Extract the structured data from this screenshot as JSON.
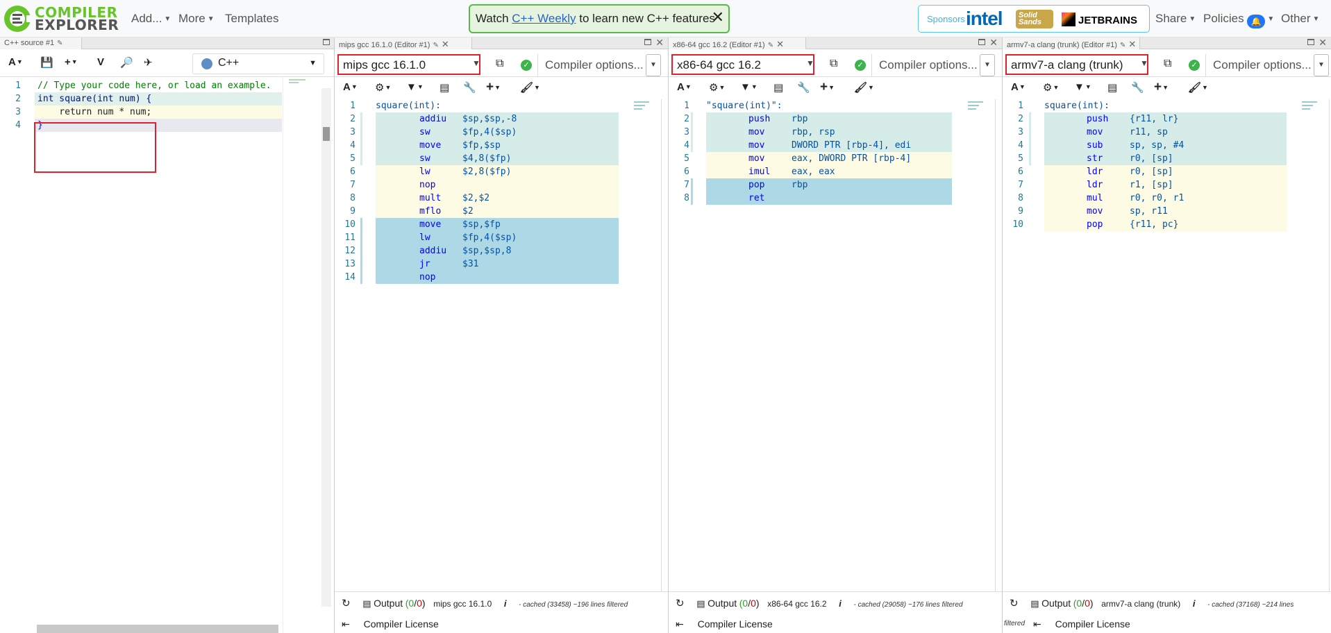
{
  "app": {
    "logo_line1": "COMPILER",
    "logo_line2": "EXPLORER",
    "nav": {
      "add": "Add...",
      "more": "More",
      "templates": "Templates",
      "share": "Share",
      "policies": "Policies",
      "other": "Other"
    },
    "banner": {
      "prefix": "Watch ",
      "link": "C++ Weekly",
      "suffix": " to learn new C++ features"
    },
    "sponsors": {
      "label": "Sponsors",
      "intel": "intel",
      "solid": "Solid Sands",
      "jetbrains": "JETBRAINS"
    }
  },
  "editor": {
    "tab_label": "C++ source #1",
    "language": "C++",
    "lines": [
      {
        "n": "1",
        "text": "// Type your code here, or load an example."
      },
      {
        "n": "2",
        "text": "int square(int num) {"
      },
      {
        "n": "3",
        "text": "    return num * num;"
      },
      {
        "n": "4",
        "text": "}"
      }
    ]
  },
  "panes": [
    {
      "tab_label": "mips gcc 16.1.0 (Editor #1)",
      "compiler": "mips gcc 16.1.0",
      "options_placeholder": "Compiler options...",
      "label": "square(int):",
      "lines": [
        {
          "n": "2",
          "op": "addiu",
          "args": "$sp,$sp,-8",
          "bg": "teal"
        },
        {
          "n": "3",
          "op": "sw",
          "args": "$fp,4($sp)",
          "bg": "teal"
        },
        {
          "n": "4",
          "op": "move",
          "args": "$fp,$sp",
          "bg": "teal"
        },
        {
          "n": "5",
          "op": "sw",
          "args": "$4,8($fp)",
          "bg": "teal"
        },
        {
          "n": "6",
          "op": "lw",
          "args": "$2,8($fp)",
          "bg": "yellow"
        },
        {
          "n": "7",
          "op": "nop",
          "args": "",
          "bg": "yellow"
        },
        {
          "n": "8",
          "op": "mult",
          "args": "$2,$2",
          "bg": "yellow"
        },
        {
          "n": "9",
          "op": "mflo",
          "args": "$2",
          "bg": "yellow"
        },
        {
          "n": "10",
          "op": "move",
          "args": "$sp,$fp",
          "bg": "blue"
        },
        {
          "n": "11",
          "op": "lw",
          "args": "$fp,4($sp)",
          "bg": "blue"
        },
        {
          "n": "12",
          "op": "addiu",
          "args": "$sp,$sp,8",
          "bg": "blue"
        },
        {
          "n": "13",
          "op": "jr",
          "args": "$31",
          "bg": "blue"
        },
        {
          "n": "14",
          "op": "nop",
          "args": "",
          "bg": "blue"
        }
      ],
      "output_label": "Output",
      "output_counts": "(0/0)",
      "status_compiler": "mips gcc 16.1.0",
      "cache_note": "- cached (33458) ~196 lines filtered",
      "license": "Compiler License"
    },
    {
      "tab_label": "x86-64 gcc 16.2 (Editor #1)",
      "compiler": "x86-64 gcc 16.2",
      "options_placeholder": "Compiler options...",
      "label": "\"square(int)\":",
      "lines": [
        {
          "n": "2",
          "op": "push",
          "args": "rbp",
          "bg": "teal"
        },
        {
          "n": "3",
          "op": "mov",
          "args": "rbp, rsp",
          "bg": "teal"
        },
        {
          "n": "4",
          "op": "mov",
          "args": "DWORD PTR [rbp-4], edi",
          "bg": "teal"
        },
        {
          "n": "5",
          "op": "mov",
          "args": "eax, DWORD PTR [rbp-4]",
          "bg": "yellow"
        },
        {
          "n": "6",
          "op": "imul",
          "args": "eax, eax",
          "bg": "yellow"
        },
        {
          "n": "7",
          "op": "pop",
          "args": "rbp",
          "bg": "blue"
        },
        {
          "n": "8",
          "op": "ret",
          "args": "",
          "bg": "blue"
        }
      ],
      "output_label": "Output",
      "output_counts": "(0/0)",
      "status_compiler": "x86-64 gcc 16.2",
      "cache_note": "- cached (29058) ~176 lines filtered",
      "license": "Compiler License"
    },
    {
      "tab_label": "armv7-a clang (trunk) (Editor #1)",
      "compiler": "armv7-a clang (trunk)",
      "options_placeholder": "Compiler options...",
      "label": "square(int):",
      "lines": [
        {
          "n": "2",
          "op": "push",
          "args": "{r11, lr}",
          "bg": "teal"
        },
        {
          "n": "3",
          "op": "mov",
          "args": "r11, sp",
          "bg": "teal"
        },
        {
          "n": "4",
          "op": "sub",
          "args": "sp, sp, #4",
          "bg": "teal"
        },
        {
          "n": "5",
          "op": "str",
          "args": "r0, [sp]",
          "bg": "teal"
        },
        {
          "n": "6",
          "op": "ldr",
          "args": "r0, [sp]",
          "bg": "yellow"
        },
        {
          "n": "7",
          "op": "ldr",
          "args": "r1, [sp]",
          "bg": "yellow"
        },
        {
          "n": "8",
          "op": "mul",
          "args": "r0, r0, r1",
          "bg": "yellow"
        },
        {
          "n": "9",
          "op": "mov",
          "args": "sp, r11",
          "bg": "yellow"
        },
        {
          "n": "10",
          "op": "pop",
          "args": "{r11, pc}",
          "bg": "yellow"
        }
      ],
      "output_label": "Output",
      "output_counts": "(0/0)",
      "status_compiler": "armv7-a clang (trunk)",
      "cache_note": "- cached (37168) ~214 lines",
      "cache_note2": "filtered",
      "license": "Compiler License"
    }
  ],
  "colors": {
    "teal": "#d5ece8",
    "yellow": "#fdfbe3",
    "blue": "#add8e6",
    "brand_green": "#67c52a",
    "highlight_red": "#e0202b"
  }
}
